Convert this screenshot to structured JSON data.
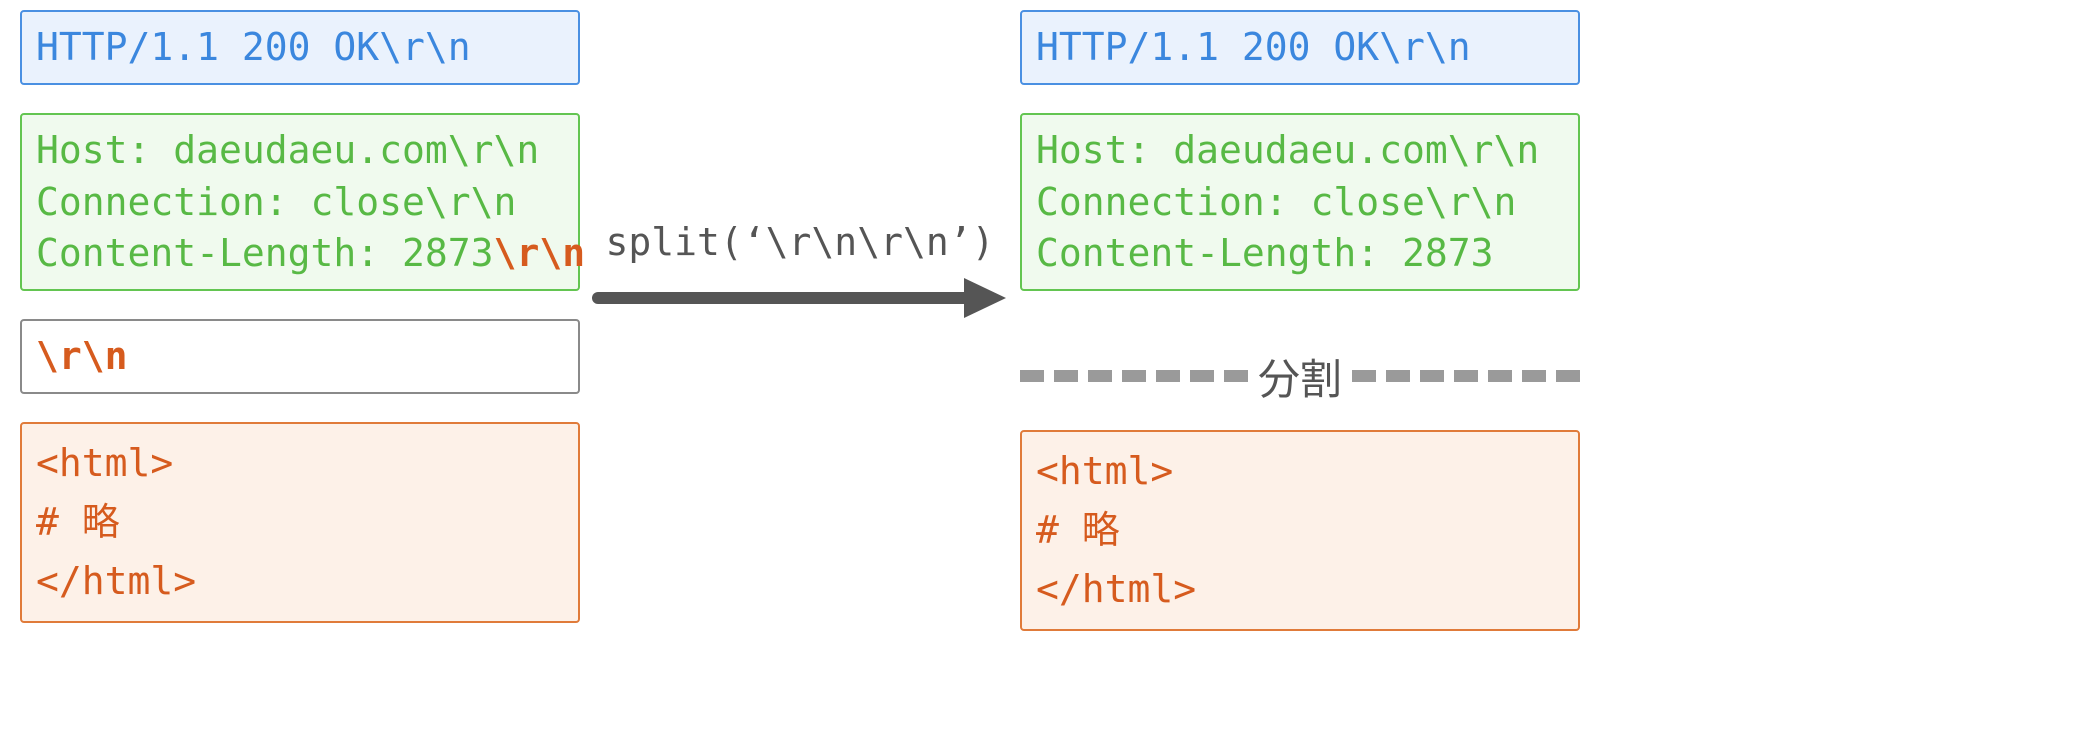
{
  "left": {
    "status": "HTTP/1.1 200 OK\\r\\n",
    "headers_pre": "Host: daeudaeu.com\\r\\n\nConnection: close\\r\\n\nContent-Length: 2873",
    "headers_emph": "\\r\\n",
    "separator": "\\r\\n",
    "body": "<html>\n# 略\n</html>"
  },
  "right": {
    "status": "HTTP/1.1 200 OK\\r\\n",
    "headers": "Host: daeudaeu.com\\r\\n\nConnection: close\\r\\n\nContent-Length: 2873",
    "body": "<html>\n# 略\n</html>"
  },
  "arrow_label": "split(‘\\r\\n\\r\\n’)",
  "divider_label": "分割"
}
